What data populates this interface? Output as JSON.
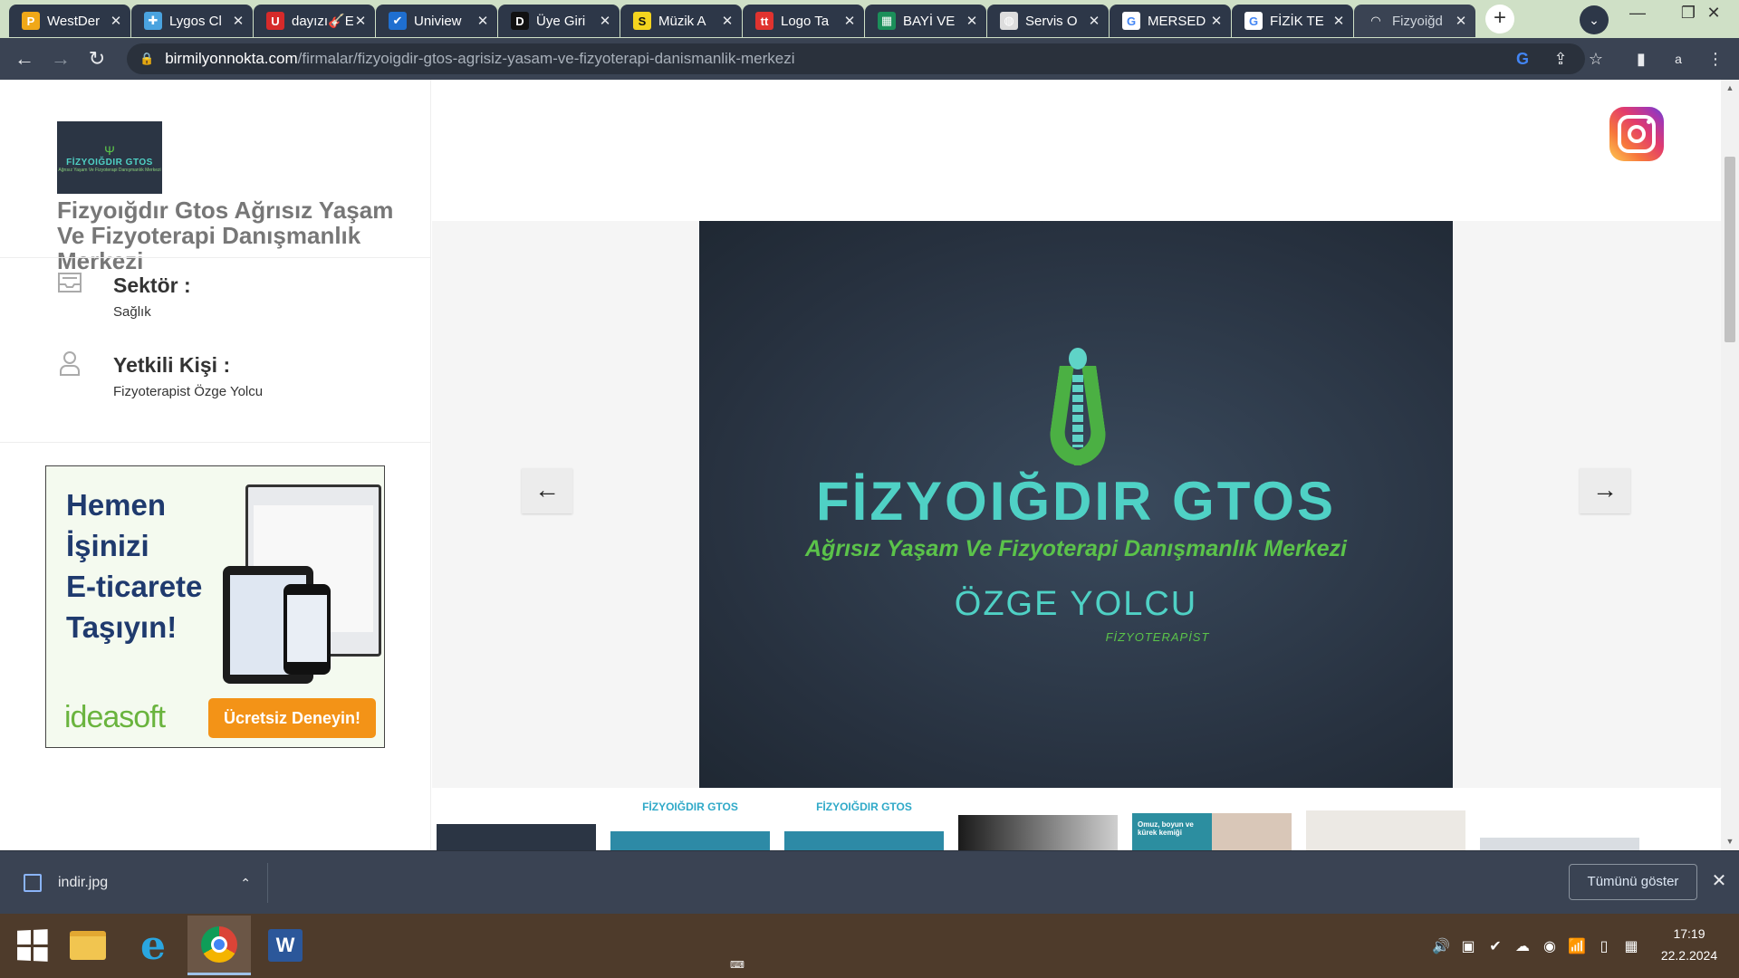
{
  "browser": {
    "tabs": [
      {
        "title": "WestDer",
        "favicon_color": "#f0a818",
        "favicon_glyph": "P",
        "close": "✕"
      },
      {
        "title": "Lygos Cl",
        "favicon_color": "#4aa3df",
        "favicon_glyph": "✚",
        "close": "✕"
      },
      {
        "title": "dayızı🎸E",
        "favicon_color": "#d62a2a",
        "favicon_glyph": "U",
        "close": "✕"
      },
      {
        "title": "Uniview",
        "favicon_color": "#1f6fd0",
        "favicon_glyph": "✔",
        "close": "✕"
      },
      {
        "title": "Üye Giri",
        "favicon_color": "#111111",
        "favicon_glyph": "D",
        "close": "✕"
      },
      {
        "title": "Müzik A",
        "favicon_color": "#f4d41e",
        "favicon_glyph": "S",
        "close": "✕"
      },
      {
        "title": "Logo Ta",
        "favicon_color": "#e0332f",
        "favicon_glyph": "tt",
        "close": "✕"
      },
      {
        "title": "BAYİ VE",
        "favicon_color": "#1b8f5a",
        "favicon_glyph": "▦",
        "close": "✕"
      },
      {
        "title": "Servis O",
        "favicon_color": "#dddddd",
        "favicon_glyph": "◍",
        "close": "✕"
      },
      {
        "title": "MERSED",
        "favicon_color": "#ffffff",
        "favicon_glyph": "G",
        "close": "✕"
      },
      {
        "title": "FİZİK TE",
        "favicon_color": "#ffffff",
        "favicon_glyph": "G",
        "close": "✕"
      },
      {
        "title": "Fizyoiğd",
        "favicon_color": "#3a4353",
        "favicon_glyph": "◠",
        "close": "✕",
        "active": true
      }
    ],
    "new_tab": "+",
    "tab_search": "⌄",
    "window_controls": {
      "minimize": "—",
      "maximize": "❐",
      "close": "✕"
    },
    "nav": {
      "back": "←",
      "forward": "→",
      "reload": "↻"
    },
    "url": {
      "lock": "🔒",
      "host": "birmilyonnokta.com",
      "path": "/firmalar/fizyoigdir-gtos-agrisiz-yasam-ve-fizyoterapi-danismanlik-merkezi"
    },
    "omnibox_icons": {
      "google": "G",
      "share": "⇪",
      "bookmark": "☆",
      "sidepanel": "▮",
      "profile": "a",
      "menu": "⋮"
    }
  },
  "page": {
    "company_logo": {
      "line1": "FİZYOIĞDIR GTOS",
      "line2": "Ağrısız Yaşam Ve Fizyoterapi Danışmanlık Merkezi"
    },
    "company_name": "Fizyoığdır Gtos Ağrısız Yaşam Ve Fizyoterapi Danışmanlık Merkezi",
    "sector_label": "Sektör :",
    "sector_value": "Sağlık",
    "contact_label": "Yetkili Kişi :",
    "contact_value": "Fizyoterapist Özge Yolcu",
    "ad": {
      "headline": [
        "Hemen",
        "İşinizi",
        "E-ticarete",
        "Taşıyın!"
      ],
      "brand": "ideasoft",
      "cta": "Ücretsiz Deneyin!"
    },
    "hero": {
      "line1": "FİZYOIĞDIR GTOS",
      "line2": "Ağrısız Yaşam Ve Fizyoterapi Danışmanlık Merkezi",
      "line3": "ÖZGE YOLCU",
      "line4": "FİZYOTERAPİST"
    },
    "slider": {
      "prev": "←",
      "next": "→"
    },
    "thumbnails": [
      {
        "kind": "dark",
        "text": ""
      },
      {
        "kind": "logo-light",
        "text": "FİZYOIĞDIR GTOS"
      },
      {
        "kind": "logo-light",
        "text": "FİZYOIĞDIR GTOS"
      },
      {
        "kind": "skeleton",
        "text": ""
      },
      {
        "kind": "photo-teal",
        "text": "Omuz, boyun ve kürek kemiği"
      },
      {
        "kind": "photo-room",
        "text": ""
      },
      {
        "kind": "photo-partial",
        "text": ""
      }
    ]
  },
  "downloads": {
    "file_name": "indir.jpg",
    "show_all": "Tümünü göster",
    "close": "✕",
    "chevron": "⌃"
  },
  "taskbar": {
    "apps": [
      "start",
      "file-explorer",
      "internet-explorer",
      "chrome",
      "word"
    ],
    "word_glyph": "W",
    "ie_glyph": "e",
    "time": "17:19",
    "date": "22.2.2024",
    "tray_icons": [
      "🔊",
      "▣",
      "✔",
      "☁",
      "◉",
      "📶",
      "▯",
      "▦"
    ]
  }
}
